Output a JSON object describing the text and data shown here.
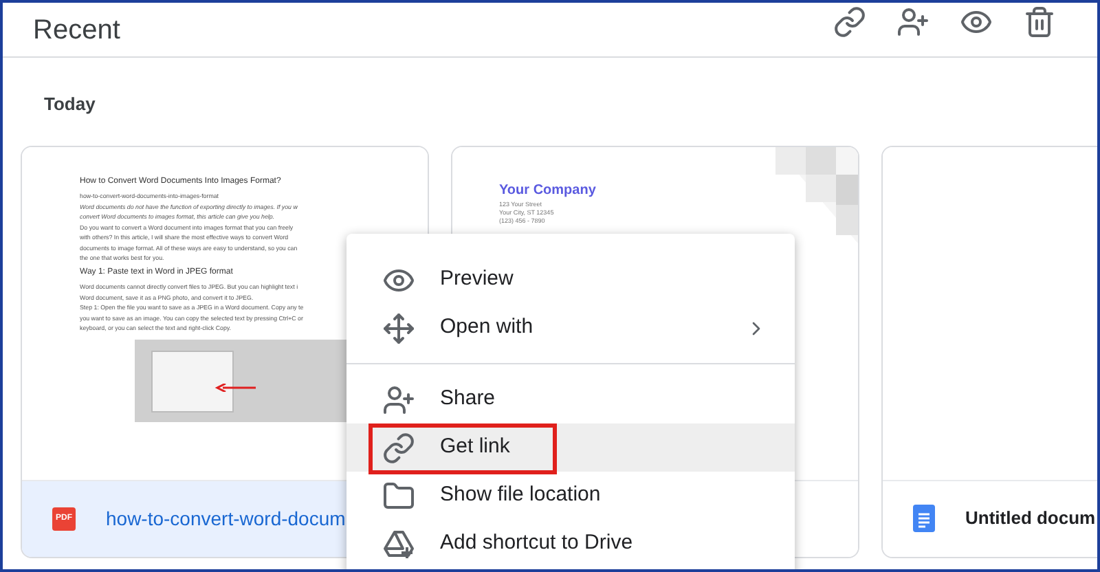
{
  "header": {
    "title": "Recent"
  },
  "section": {
    "title": "Today"
  },
  "files": [
    {
      "kind": "pdf",
      "badge": "PDF",
      "name": "how-to-convert-word-docum",
      "selected": true,
      "preview": {
        "kind": "article",
        "lines": [
          {
            "kind": "heading",
            "text": "How to Convert Word Documents Into Images Format?"
          },
          {
            "kind": "body",
            "text": "how-to-convert-word-documents-into-images-format"
          },
          {
            "kind": "italic",
            "text": "Word documents do not have the function of exporting directly to images. If you w"
          },
          {
            "kind": "italic",
            "text": "convert Word documents to images format, this article can give you help."
          },
          {
            "kind": "body",
            "text": "Do you want to convert a Word document into images format that you can freely"
          },
          {
            "kind": "body",
            "text": "with others? In this article, I will share the most effective ways to convert Word"
          },
          {
            "kind": "body",
            "text": "documents to image format. All of these ways are easy to understand, so you can"
          },
          {
            "kind": "body",
            "text": "the one that works best for you."
          },
          {
            "kind": "subheading",
            "text": "Way 1: Paste text in Word in JPEG format"
          },
          {
            "kind": "body",
            "text": "Word documents cannot directly convert files to JPEG. But you can highlight text i"
          },
          {
            "kind": "body",
            "text": "Word document, save it as a PNG photo, and convert it to JPEG."
          },
          {
            "kind": "body",
            "text": "Step 1: Open the file you want to save as a JPEG in a Word document. Copy any te"
          },
          {
            "kind": "body",
            "text": "you want to save as an image. You can copy the selected text by pressing Ctrl+C or"
          },
          {
            "kind": "body",
            "text": "keyboard, or you can select the text and right-click Copy."
          }
        ]
      }
    },
    {
      "kind": "letter",
      "selected": false,
      "preview": {
        "kind": "letter",
        "company": "Your Company",
        "lines": [
          "123 Your Street",
          "Your City, ST 12345",
          "(123) 456 - 7890"
        ]
      }
    },
    {
      "kind": "doc",
      "name": "Untitled docum",
      "selected": false,
      "preview": {
        "kind": "blank"
      }
    }
  ],
  "menu": [
    {
      "kind": "item",
      "label": "Preview",
      "submenu": false,
      "selected": false
    },
    {
      "kind": "item",
      "label": "Open with",
      "submenu": true,
      "selected": false
    },
    {
      "kind": "divider"
    },
    {
      "kind": "item",
      "label": "Share",
      "submenu": false,
      "selected": false
    },
    {
      "kind": "item",
      "label": "Get link",
      "submenu": false,
      "selected": true
    },
    {
      "kind": "item",
      "label": "Show file location",
      "submenu": false,
      "selected": false
    },
    {
      "kind": "item",
      "label": "Add shortcut to Drive",
      "submenu": false,
      "selected": false
    }
  ]
}
